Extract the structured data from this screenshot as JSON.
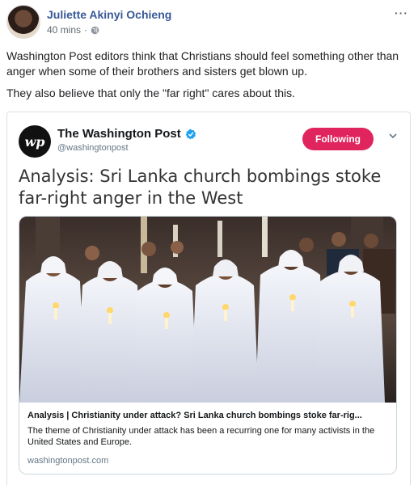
{
  "post": {
    "author": "Juliette Akinyi Ochieng",
    "time": "40 mins",
    "separator": "·",
    "more": "···",
    "paragraphs": [
      "Washington Post editors think that Christians should feel something other than anger when some of their brothers and sisters get blown up.",
      "They also believe that only the \"far right\" cares about this."
    ]
  },
  "embed": {
    "account_name": "The Washington Post",
    "account_handle": "@washingtonpost",
    "logo_text": "wp",
    "follow_label": "Following",
    "headline": "Analysis: Sri Lanka church bombings stoke far-right anger in the West",
    "card": {
      "title": "Analysis | Christianity under attack? Sri Lanka church bombings stoke far-rig...",
      "description": "The theme of Christianity under attack has been a recurring one for many activists in the United States and Europe.",
      "domain": "washingtonpost.com"
    }
  },
  "colors": {
    "author_link": "#385898",
    "follow_button": "#e0245e",
    "verified": "#1da1f2"
  }
}
